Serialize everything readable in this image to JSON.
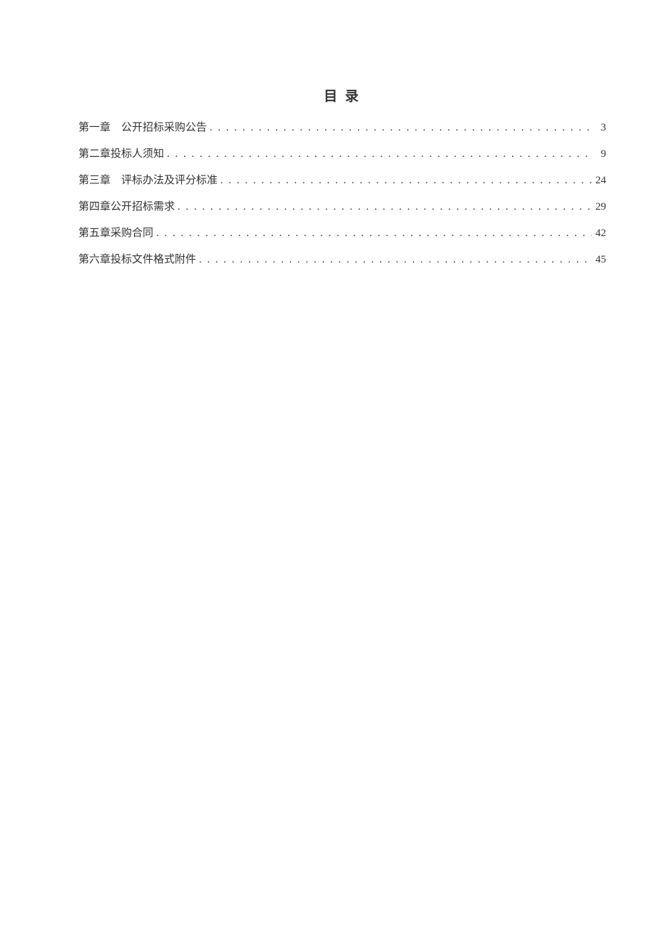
{
  "title": "目 录",
  "toc": [
    {
      "label": "第一章　公开招标采购公告",
      "page": "3"
    },
    {
      "label": "第二章投标人须知",
      "page": "9"
    },
    {
      "label": "第三章　评标办法及评分标准",
      "page": "24"
    },
    {
      "label": "第四章公开招标需求",
      "page": "29"
    },
    {
      "label": "第五章采购合同",
      "page": "42"
    },
    {
      "label": "第六章投标文件格式附件",
      "page": "45"
    }
  ]
}
